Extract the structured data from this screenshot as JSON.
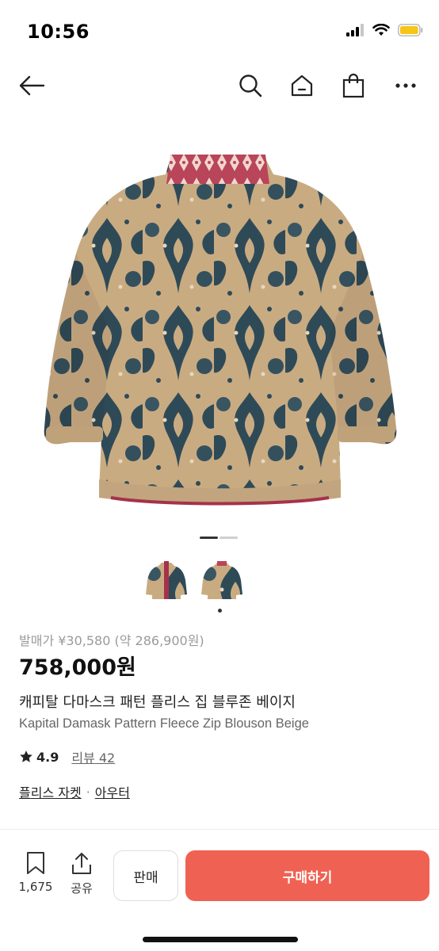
{
  "status": {
    "time": "10:56"
  },
  "nav": {
    "icons": [
      "back-arrow-icon",
      "search-icon",
      "home-icon",
      "shopping-bag-icon",
      "more-icon"
    ]
  },
  "gallery": {
    "page_count": 2,
    "current_page": 1,
    "thumbnails": [
      "front-view",
      "back-view"
    ]
  },
  "product": {
    "release_price": "발매가 ¥30,580 (약 286,900원)",
    "price": "758,000원",
    "title_ko": "캐피탈 다마스크 패턴 플리스 집 블루존 베이지",
    "title_en": "Kapital Damask Pattern Fleece Zip Blouson Beige",
    "rating": "4.9",
    "reviews": "리뷰 42",
    "category_1": "플리스 자켓",
    "category_separator": "·",
    "category_2": "아우터"
  },
  "bottom": {
    "bookmark_count": "1,675",
    "share_label": "공유",
    "sell_label": "판매",
    "buy_label": "구매하기"
  },
  "colors": {
    "accent": "#ef6253",
    "fleece_beige": "#c9ab82",
    "damask_blue": "#2f4a57",
    "trim_red": "#a5324a"
  }
}
